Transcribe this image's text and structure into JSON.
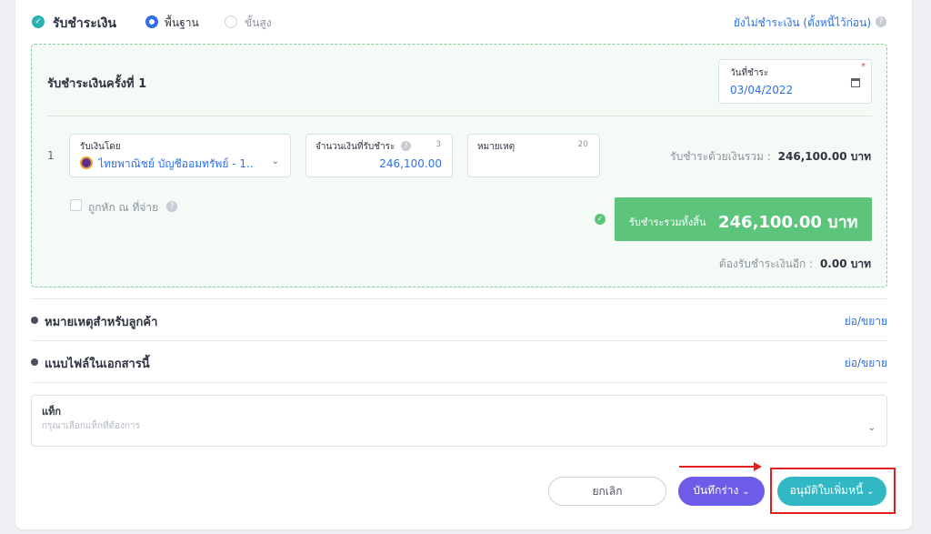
{
  "payment": {
    "title": "รับชำระเงิน",
    "mode_basic": "พื้นฐาน",
    "mode_advanced": "ขั้นสูง",
    "unpaid_link": "ยังไม่ชำระเงิน (ตั้งหนี้ไว้ก่อน)",
    "round_title": "รับชำระเงินครั้งที่ 1",
    "date_label": "วันที่ชำระ",
    "date_value": "03/04/2022",
    "row_number": "1",
    "received_by_label": "รับเงินโดย",
    "received_by_value": "ไทยพาณิชย์ บัญชีออมทรัพย์ - 1...",
    "amount_label": "จำนวนเงินที่รับชำระ",
    "amount_count": "3",
    "amount_value": "246,100.00",
    "note_label": "หมายเหตุ",
    "note_count": "20",
    "received_total_label": "รับชำระด้วยเงินรวม :",
    "received_total_value": "246,100.00 บาท",
    "withholding_label": "ถูกหัก ณ ที่จ่าย",
    "grand_total_label": "รับชำระรวมทั้งสิ้น",
    "grand_total_value": "246,100.00 บาท",
    "remaining_label": "ต้องรับชำระเงินอีก :",
    "remaining_value": "0.00 บาท"
  },
  "sections": {
    "customer_note": "หมายเหตุสำหรับลูกค้า",
    "customer_note_toggle": "ย่อ/ขยาย",
    "attachments": "แนบไฟล์ในเอกสารนี้",
    "attachments_toggle": "ย่อ/ขยาย"
  },
  "tags": {
    "label": "แท็ก",
    "placeholder": "กรุณาเลือกแท็กที่ต้องการ"
  },
  "footer": {
    "cancel": "ยกเลิก",
    "save_draft": "บันทึกร่าง",
    "approve": "อนุมัติใบเพิ่มหนี้"
  },
  "colors": {
    "accent_blue": "#2f6fe8",
    "teal": "#27b3b0",
    "green": "#5cc47b",
    "purple": "#6c5ce7",
    "highlight_red": "#e02020"
  }
}
